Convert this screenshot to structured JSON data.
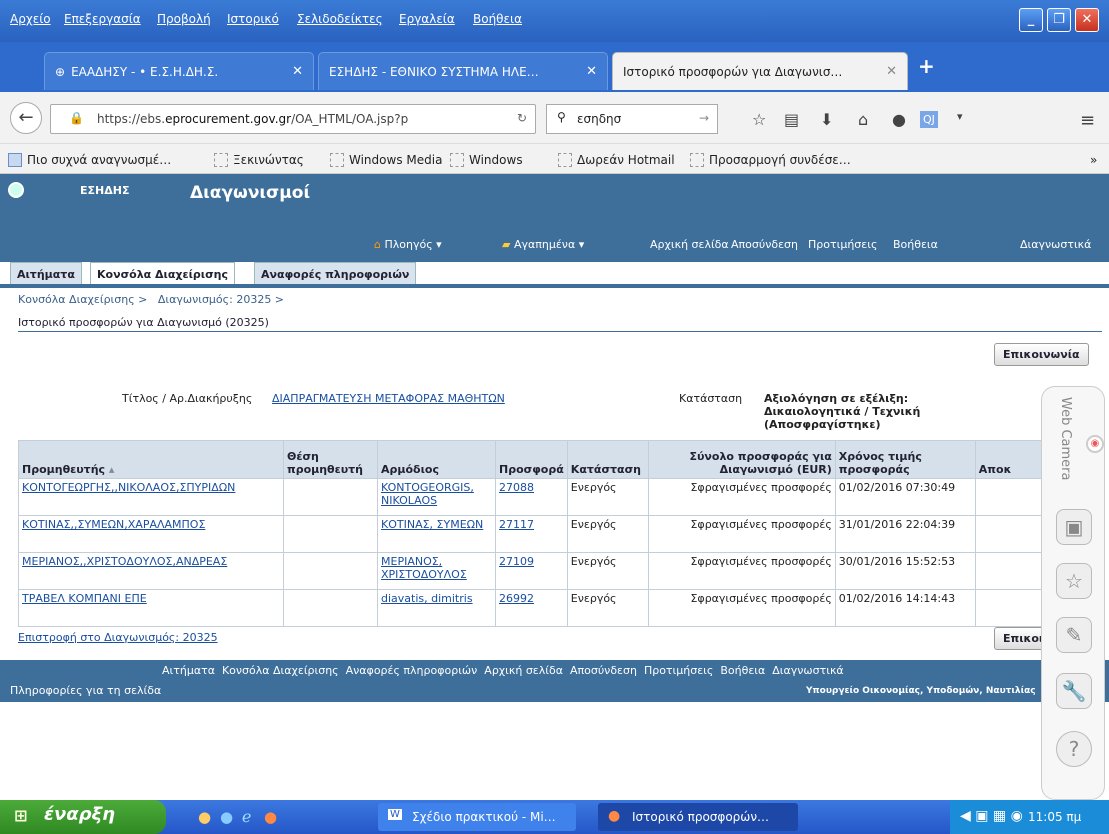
{
  "menu": [
    "Αρχείο",
    "Επεξεργασία",
    "Προβολή",
    "Ιστορικό",
    "Σελιδοδείκτες",
    "Εργαλεία",
    "Βοήθεια"
  ],
  "tabs": [
    {
      "label": "ΕΑΑΔΗΣΥ - • Ε.Σ.Η.ΔΗ.Σ."
    },
    {
      "label": "ΕΣΗΔΗΣ - ΕΘΝΙΚΟ ΣΥΣΤΗΜΑ ΗΛΕ…"
    },
    {
      "label": "Ιστορικό προσφορών για Διαγωνισ…"
    }
  ],
  "nav": {
    "url_prefix": "https://ebs.",
    "url_domain": "eprocurement.gov.gr",
    "url_rest": "/OA_HTML/OA.jsp?p",
    "search": "εσηδησ"
  },
  "bookmarks": [
    "Πιο συχνά αναγνωσμέ…",
    "Ξεκινώντας",
    "Windows Media",
    "Windows",
    "Δωρεάν Hotmail",
    "Προσαρμογή συνδέσε…"
  ],
  "app": {
    "brand": "ΕΣΗΔΗΣ",
    "title": "Διαγωνισμοί",
    "nav_menu": "Πλοηγός",
    "favorites": "Αγαπημένα",
    "links": [
      "Αρχική σελίδα",
      "Αποσύνδεση",
      "Προτιμήσεις",
      "Βοήθεια",
      "Διαγνωστικά"
    ],
    "tabs": [
      "Αιτήματα",
      "Κονσόλα Διαχείρισης",
      "Αναφορές πληροφοριών"
    ],
    "breadcrumb": [
      "Κονσόλα Διαχείρισης",
      "Διαγωνισμός: 20325"
    ],
    "page_title": "Ιστορικό προσφορών για Διαγωνισμό (20325)",
    "contact": "Επικοινωνία",
    "contact_short": "Επικοιν",
    "field_title_label": "Τίτλος / Αρ.Διακήρυξης",
    "field_title_value": "ΔΙΑΠΡΑΓΜΑΤΕΥΣΗ ΜΕΤΑΦΟΡΑΣ ΜΑΘΗΤΩΝ",
    "field_status_label": "Κατάσταση",
    "field_status_value": "Αξιολόγηση σε εξέλιξη: Δικαιολογητικά / Τεχνική (Αποσφραγίστηκε)",
    "columns": [
      "Προμηθευτής",
      "Θέση προμηθευτή",
      "Αρμόδιος",
      "Προσφορά",
      "Κατάσταση",
      "Σύνολο προσφοράς για Διαγωνισμό (EUR)",
      "Χρόνος τιμής προσφοράς",
      "Αποκ"
    ],
    "rows": [
      {
        "supplier": "ΚΟΝΤΟΓΕΩΡΓΗΣ,,ΝΙΚΟΛΑΟΣ,ΣΠΥΡΙΔΩΝ",
        "contact": "KONTOGEORGIS, NIKOLAOS",
        "offer": "27088",
        "status": "Ενεργός",
        "total": "Σφραγισμένες προσφορές",
        "time": "01/02/2016 07:30:49"
      },
      {
        "supplier": "ΚΟΤΙΝΑΣ,,ΣΥΜΕΩΝ,ΧΑΡΑΛΑΜΠΟΣ",
        "contact": "ΚΟΤΙΝΑΣ, ΣΥΜΕΩΝ",
        "offer": "27117",
        "status": "Ενεργός",
        "total": "Σφραγισμένες προσφορές",
        "time": "31/01/2016 22:04:39"
      },
      {
        "supplier": "ΜΕΡΙΑΝΟΣ,,ΧΡΙΣΤΟΔΟΥΛΟΣ,ΑΝΔΡΕΑΣ",
        "contact": "ΜΕΡΙΑΝΟΣ, ΧΡΙΣΤΟΔΟΥΛΟΣ",
        "offer": "27109",
        "status": "Ενεργός",
        "total": "Σφραγισμένες προσφορές",
        "time": "30/01/2016 15:52:53"
      },
      {
        "supplier": "ΤΡΑΒΕΛ ΚΟΜΠΑΝΙ ΕΠΕ",
        "contact": "diavatis, dimitris",
        "offer": "26992",
        "status": "Ενεργός",
        "total": "Σφραγισμένες προσφορές",
        "time": "01/02/2016 14:14:43"
      }
    ],
    "return_link": "Επιστροφή στο Διαγωνισμός: 20325",
    "footer_links": [
      "Αιτήματα",
      "Κονσόλα Διαχείρισης",
      "Αναφορές πληροφοριών",
      "Αρχική σελίδα",
      "Αποσύνδεση",
      "Προτιμήσεις",
      "Βοήθεια",
      "Διαγνωστικά"
    ],
    "page_info": "Πληροφορίες για τη σελίδα",
    "ministry": "Υπουργείο Οικονομίας, Υποδομών, Ναυτιλίας"
  },
  "side": {
    "label": "Web Camera"
  },
  "taskbar": {
    "start": "έναρξη",
    "items": [
      "Σχέδιο πρακτικού - Mi…",
      "Ιστορικό προσφορών…"
    ],
    "clock": "11:05 πμ"
  }
}
